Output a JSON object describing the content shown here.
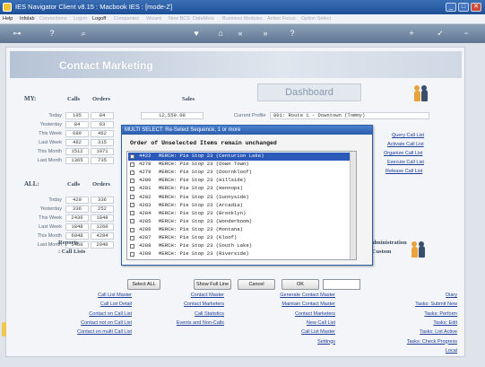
{
  "window": {
    "title": "IES Navigator Client v8.15 : Macbook IES :     [mode-Z]",
    "buttons": [
      "_",
      "□",
      "✕"
    ]
  },
  "menubar": {
    "items": [
      "Help",
      "Infolab",
      "Connections",
      "Logon",
      "Logoff",
      "Companies",
      "Wizard",
      "New BCS",
      "DataMeta",
      "Business Modules",
      "Action Focus",
      "Option Select"
    ]
  },
  "toolbar": {
    "icons": [
      "key-icon",
      "help-icon",
      "search-icon",
      "heart-icon",
      "home-icon",
      "back-icon",
      "forward-icon",
      "help-icon-2",
      "add-icon",
      "check-icon",
      "remove-icon"
    ]
  },
  "banner": {
    "title": "Contact Marketing"
  },
  "my": {
    "label": "MY:",
    "col_calls": "Calls",
    "col_orders": "Orders",
    "col_sales": "Sales",
    "rows": [
      {
        "label": "Today",
        "calls": "105",
        "orders": "84",
        "sales": "12,550.00"
      },
      {
        "label": "Yesterday",
        "calls": "84",
        "orders": "63",
        "sales": ""
      },
      {
        "label": "This Week",
        "calls": "689",
        "orders": "462",
        "sales": ""
      },
      {
        "label": "Last Week",
        "calls": "462",
        "orders": "315",
        "sales": ""
      },
      {
        "label": "This Month",
        "calls": "1512",
        "orders": "1071",
        "sales": ""
      },
      {
        "label": "Last Month",
        "calls": "1365",
        "orders": "735",
        "sales": ""
      }
    ]
  },
  "all": {
    "label": "ALL:",
    "col_calls": "Calls",
    "col_orders": "Orders",
    "rows": [
      {
        "label": "Today",
        "calls": "420",
        "orders": "336"
      },
      {
        "label": "Yesterday",
        "calls": "336",
        "orders": "252"
      },
      {
        "label": "This Week",
        "calls": "2436",
        "orders": "1848"
      },
      {
        "label": "Last Week",
        "calls": "1848",
        "orders": "1260"
      },
      {
        "label": "This Month",
        "calls": "6048",
        "orders": "4284"
      },
      {
        "label": "Last Month",
        "calls": "5460",
        "orders": "2940"
      }
    ]
  },
  "dashboard": {
    "title": "Dashboard",
    "profile_label": "Current Profile",
    "profile_value": "001: Route 1 - Downtown (Tommy)"
  },
  "right_links": [
    "Query Call List",
    "Activate Call List",
    "Organize Call List",
    "Execute Call List",
    "Release Call List"
  ],
  "dialog": {
    "title": "MULTI SELECT: Re-Select Sequence, 1 or more",
    "subtitle": "Order of Unselected Items remain unchanged",
    "items": [
      {
        "code": "4422",
        "text": "MERCH: Pie Stop 23 (Centurion Lake)",
        "selected": true
      },
      {
        "code": "4278",
        "text": "MERCH: Pie Stop 23 (Down Town)",
        "selected": false
      },
      {
        "code": "4279",
        "text": "MERCH: Pie Stop 23 (Doornkloof)",
        "selected": false
      },
      {
        "code": "4280",
        "text": "MERCH: Pie Stop 23 (Hillside)",
        "selected": false
      },
      {
        "code": "4281",
        "text": "MERCH: Pie Stop 23 (Hennops)",
        "selected": false
      },
      {
        "code": "4282",
        "text": "MERCH: Pie Stop 23 (Sunnyside)",
        "selected": false
      },
      {
        "code": "4283",
        "text": "MERCH: Pie Stop 23 (Arcadia)",
        "selected": false
      },
      {
        "code": "4284",
        "text": "MERCH: Pie Stop 23 (Brooklyn)",
        "selected": false
      },
      {
        "code": "4285",
        "text": "MERCH: Pie Stop 23 (Wonderboom)",
        "selected": false
      },
      {
        "code": "4286",
        "text": "MERCH: Pie Stop 23 (Montana)",
        "selected": false
      },
      {
        "code": "4287",
        "text": "MERCH: Pie Stop 23 (Kloof)",
        "selected": false
      },
      {
        "code": "4288",
        "text": "MERCH: Pie Stop 23 (South Lake)",
        "selected": false
      },
      {
        "code": "4289",
        "text": "MERCH: Pie Stop 23 (Riverside)",
        "selected": false
      }
    ],
    "buttons": {
      "select_all": "Select ALL",
      "show_full_line": "Show Full Line",
      "cancel": "Cancel",
      "ok": "OK"
    }
  },
  "sections": {
    "reports": "Reports",
    "call_lists": ": Call Lists",
    "administration": "Administration",
    "custom": ": Custom"
  },
  "bottom_links": {
    "col1": [
      "Call List Master",
      "Call List Detail",
      "Contact on Call List",
      "Contact not on Call List",
      "Contact on multi Call List"
    ],
    "col2": [
      "Contact Master",
      "Contact Marketers",
      "Call Statistics",
      "Events and Non-Calls"
    ],
    "col3": [
      "Generate Contact Master",
      "Maintain Contact Master",
      "Contact Marketers",
      "New Call List",
      "Call List Master",
      "Settings"
    ],
    "col4": [
      "Diary",
      "Tasks: Submit New",
      "Tasks: Perform",
      "Tasks: Edit",
      "Tasks: List Active",
      "Tasks: Check Progress",
      "Local"
    ]
  },
  "colors": {
    "title_bar": "#2a5daa",
    "selection": "#2b59b8",
    "link": "#1e3d9a"
  }
}
